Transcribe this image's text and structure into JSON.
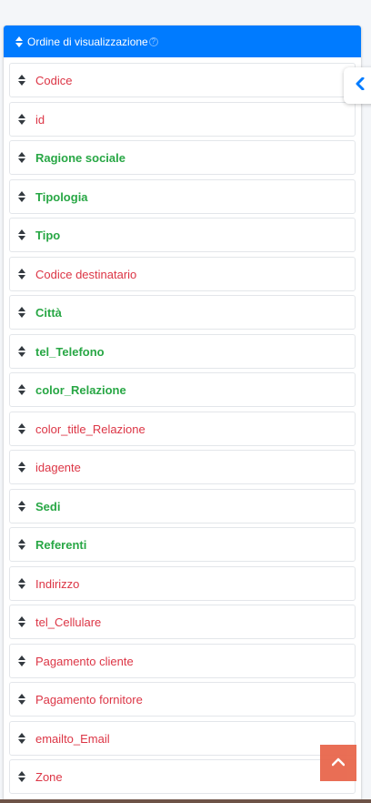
{
  "panel": {
    "title": "Ordine di visualizzazione",
    "help_icon": "question-circle-icon",
    "header_color": "#007bff"
  },
  "fields": [
    {
      "label": "Codice",
      "style": "red"
    },
    {
      "label": "id",
      "style": "red"
    },
    {
      "label": "Ragione sociale",
      "style": "green"
    },
    {
      "label": "Tipologia",
      "style": "green"
    },
    {
      "label": "Tipo",
      "style": "green"
    },
    {
      "label": "Codice destinatario",
      "style": "red"
    },
    {
      "label": "Città",
      "style": "green"
    },
    {
      "label": "tel_Telefono",
      "style": "green"
    },
    {
      "label": "color_Relazione",
      "style": "green"
    },
    {
      "label": "color_title_Relazione",
      "style": "red"
    },
    {
      "label": "idagente",
      "style": "red"
    },
    {
      "label": "Sedi",
      "style": "green"
    },
    {
      "label": "Referenti",
      "style": "green"
    },
    {
      "label": "Indirizzo",
      "style": "red"
    },
    {
      "label": "tel_Cellulare",
      "style": "red"
    },
    {
      "label": "Pagamento cliente",
      "style": "red"
    },
    {
      "label": "Pagamento fornitore",
      "style": "red"
    },
    {
      "label": "emailto_Email",
      "style": "red"
    },
    {
      "label": "Zone",
      "style": "red"
    }
  ],
  "colors": {
    "red_label": "#dc3545",
    "green_label": "#28a745",
    "back_to_top": "#e8674c"
  },
  "controls": {
    "side_toggle_icon": "chevron-left-icon",
    "back_to_top_icon": "chevron-up-icon"
  }
}
